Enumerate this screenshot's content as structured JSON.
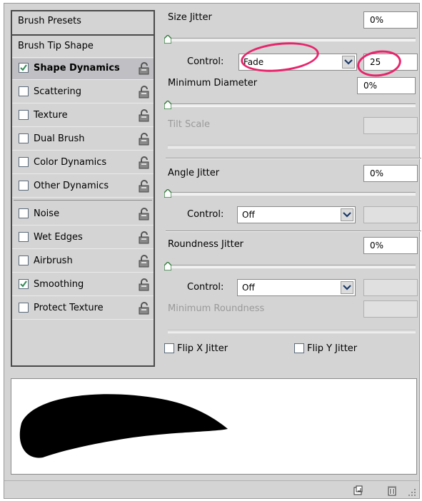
{
  "sidebar": {
    "presets_label": "Brush Presets",
    "items": [
      {
        "label": "Brush Tip Shape",
        "checked": null,
        "lock": false
      },
      {
        "label": "Shape Dynamics",
        "checked": true,
        "lock": true,
        "selected": true
      },
      {
        "label": "Scattering",
        "checked": false,
        "lock": true
      },
      {
        "label": "Texture",
        "checked": false,
        "lock": true
      },
      {
        "label": "Dual Brush",
        "checked": false,
        "lock": true
      },
      {
        "label": "Color Dynamics",
        "checked": false,
        "lock": true
      },
      {
        "label": "Other Dynamics",
        "checked": false,
        "lock": true
      },
      {
        "label": "Noise",
        "checked": false,
        "lock": true
      },
      {
        "label": "Wet Edges",
        "checked": false,
        "lock": true
      },
      {
        "label": "Airbrush",
        "checked": false,
        "lock": true
      },
      {
        "label": "Smoothing",
        "checked": true,
        "lock": true
      },
      {
        "label": "Protect Texture",
        "checked": false,
        "lock": true
      }
    ]
  },
  "settings": {
    "size_jitter": {
      "label": "Size Jitter",
      "value": "0%"
    },
    "size_control": {
      "label": "Control:",
      "value": "Fade",
      "steps": "25"
    },
    "min_diameter": {
      "label": "Minimum Diameter",
      "value": "0%"
    },
    "tilt_scale": {
      "label": "Tilt Scale",
      "value": ""
    },
    "angle_jitter": {
      "label": "Angle Jitter",
      "value": "0%"
    },
    "angle_control": {
      "label": "Control:",
      "value": "Off"
    },
    "roundness_jitter": {
      "label": "Roundness Jitter",
      "value": "0%"
    },
    "roundness_control": {
      "label": "Control:",
      "value": "Off"
    },
    "min_roundness": {
      "label": "Minimum Roundness",
      "value": ""
    },
    "flip_x": {
      "label": "Flip X Jitter",
      "checked": false
    },
    "flip_y": {
      "label": "Flip Y Jitter",
      "checked": false
    }
  },
  "colors": {
    "panel": "#d4d4d4",
    "highlight": "#e8246a",
    "check": "#2e8b57"
  },
  "icons": [
    "lock-icon",
    "new-preset-icon",
    "trash-icon",
    "resize-grip-icon",
    "chevron-down-icon",
    "slider-thumb-icon",
    "checkmark-icon"
  ]
}
